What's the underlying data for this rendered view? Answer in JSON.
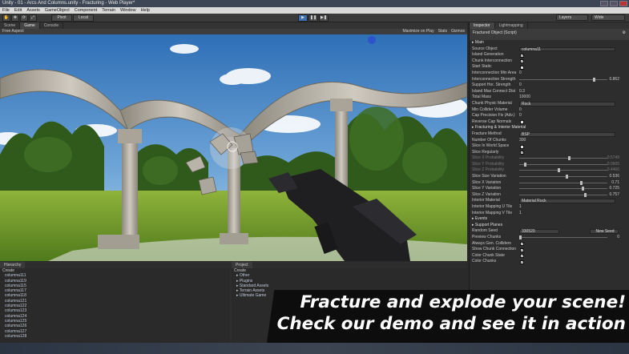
{
  "window": {
    "title": "Unity - 01 - Arcs And Columns.unity - Fracturing - Web Player*"
  },
  "menu": [
    "File",
    "Edit",
    "Assets",
    "GameObject",
    "Component",
    "Terrain",
    "Window",
    "Help"
  ],
  "toolbar": {
    "pivot": "Pivot",
    "local": "Local",
    "layers": "Layers",
    "layout": "Wide"
  },
  "scene_tabs": [
    "Scene",
    "Game",
    "Console"
  ],
  "gamebar": {
    "aspect": "Free Aspect",
    "maximize": "Maximize on Play",
    "stats": "Stats",
    "gizmos": "Gizmos"
  },
  "inspector": {
    "tabs": [
      "Inspector",
      "Lightmapping"
    ],
    "component": "Fractured Object (Script)",
    "rows": [
      {
        "label": "Main",
        "kind": "section"
      },
      {
        "label": "Source Object",
        "kind": "box",
        "value": "columna11"
      },
      {
        "label": "Island Generation",
        "kind": "check"
      },
      {
        "label": "Chunk Interconnection",
        "kind": "check"
      },
      {
        "label": "Start Static",
        "kind": "check-off"
      },
      {
        "label": "Interconnection Min Area",
        "kind": "text",
        "value": "0"
      },
      {
        "label": "Interconnection Strength",
        "kind": "slider",
        "value": "0.862",
        "pos": 0.86
      },
      {
        "label": "Support Hor. Strength",
        "kind": "text",
        "value": "0"
      },
      {
        "label": "Island Max Connect Dist",
        "kind": "text",
        "value": "0.3"
      },
      {
        "label": "Total Mass",
        "kind": "text",
        "value": "10000"
      },
      {
        "label": "Chunk Physic Material",
        "kind": "box",
        "value": "Rock"
      },
      {
        "label": "Min Collider Volume",
        "kind": "text",
        "value": "0"
      },
      {
        "label": "Cap Precision Fix (Adv.)",
        "kind": "text",
        "value": "0"
      },
      {
        "label": "Reverse Cap Normals",
        "kind": "check-off"
      },
      {
        "label": "Fracturing & Interior Material",
        "kind": "section"
      },
      {
        "label": "Fracture Method",
        "kind": "box",
        "value": "BSP"
      },
      {
        "label": "Number Of Chunks",
        "kind": "text",
        "value": "300"
      },
      {
        "label": "Slice In World Space",
        "kind": "check-off"
      },
      {
        "label": "Slice Regularly",
        "kind": "check"
      },
      {
        "label": "Slice X Probability",
        "kind": "slider-dim",
        "value": "0.5749",
        "pos": 0.57
      },
      {
        "label": "Slice Y Probability",
        "kind": "slider-dim",
        "value": "0.0605",
        "pos": 0.06
      },
      {
        "label": "Slice Z Probability",
        "kind": "slider-dim",
        "value": "0.4466",
        "pos": 0.45
      },
      {
        "label": "Slice Size Variation",
        "kind": "slider",
        "value": "0.536",
        "pos": 0.54
      },
      {
        "label": "Slice X Variation",
        "kind": "slider",
        "value": "0.71",
        "pos": 0.71
      },
      {
        "label": "Slice Y Variation",
        "kind": "slider",
        "value": "0.725",
        "pos": 0.73
      },
      {
        "label": "Slice Z Variation",
        "kind": "slider",
        "value": "0.757",
        "pos": 0.76
      },
      {
        "label": "Interior Material",
        "kind": "box",
        "value": "Material Rock"
      },
      {
        "label": "Interior Mapping U Tile",
        "kind": "text",
        "value": "1"
      },
      {
        "label": "Interior Mapping V Tile",
        "kind": "text",
        "value": "1"
      },
      {
        "label": "Events",
        "kind": "section"
      },
      {
        "label": "Support Planes",
        "kind": "section"
      },
      {
        "label": "Random Seed",
        "kind": "seed",
        "value": "330520",
        "button": "New Seed"
      },
      {
        "label": "Preview Chunks",
        "kind": "slider",
        "value": "0",
        "pos": 0.0
      },
      {
        "label": "Always Gen. Colliders",
        "kind": "check"
      },
      {
        "label": "Show Chunk Connection",
        "kind": "check"
      },
      {
        "label": "Color Chunk State",
        "kind": "check"
      },
      {
        "label": "Color Chunks",
        "kind": "check"
      }
    ]
  },
  "hierarchy": {
    "tab": "Hierarchy",
    "create": "Create",
    "items": [
      "columna111",
      "columna119",
      "columna115",
      "columna117",
      "columna118",
      "columna121",
      "columna122",
      "columna123",
      "columna124",
      "columna125",
      "columna126",
      "columna127",
      "columna128"
    ]
  },
  "project": {
    "tab": "Project",
    "create": "Create",
    "items": [
      "Other",
      "Plugins",
      "Standard Assets",
      "Terrain Assets",
      "Ultimate Game"
    ]
  },
  "banner": {
    "line1": "Fracture and explode your scene!",
    "line2": "Check our demo and see it in action"
  },
  "colors": {
    "accent": "#3b6fb0",
    "sky": "#4a86c8",
    "grass": "#6d9a2e",
    "stone": "#b7b2a6",
    "banner": "#0d0d0d"
  }
}
